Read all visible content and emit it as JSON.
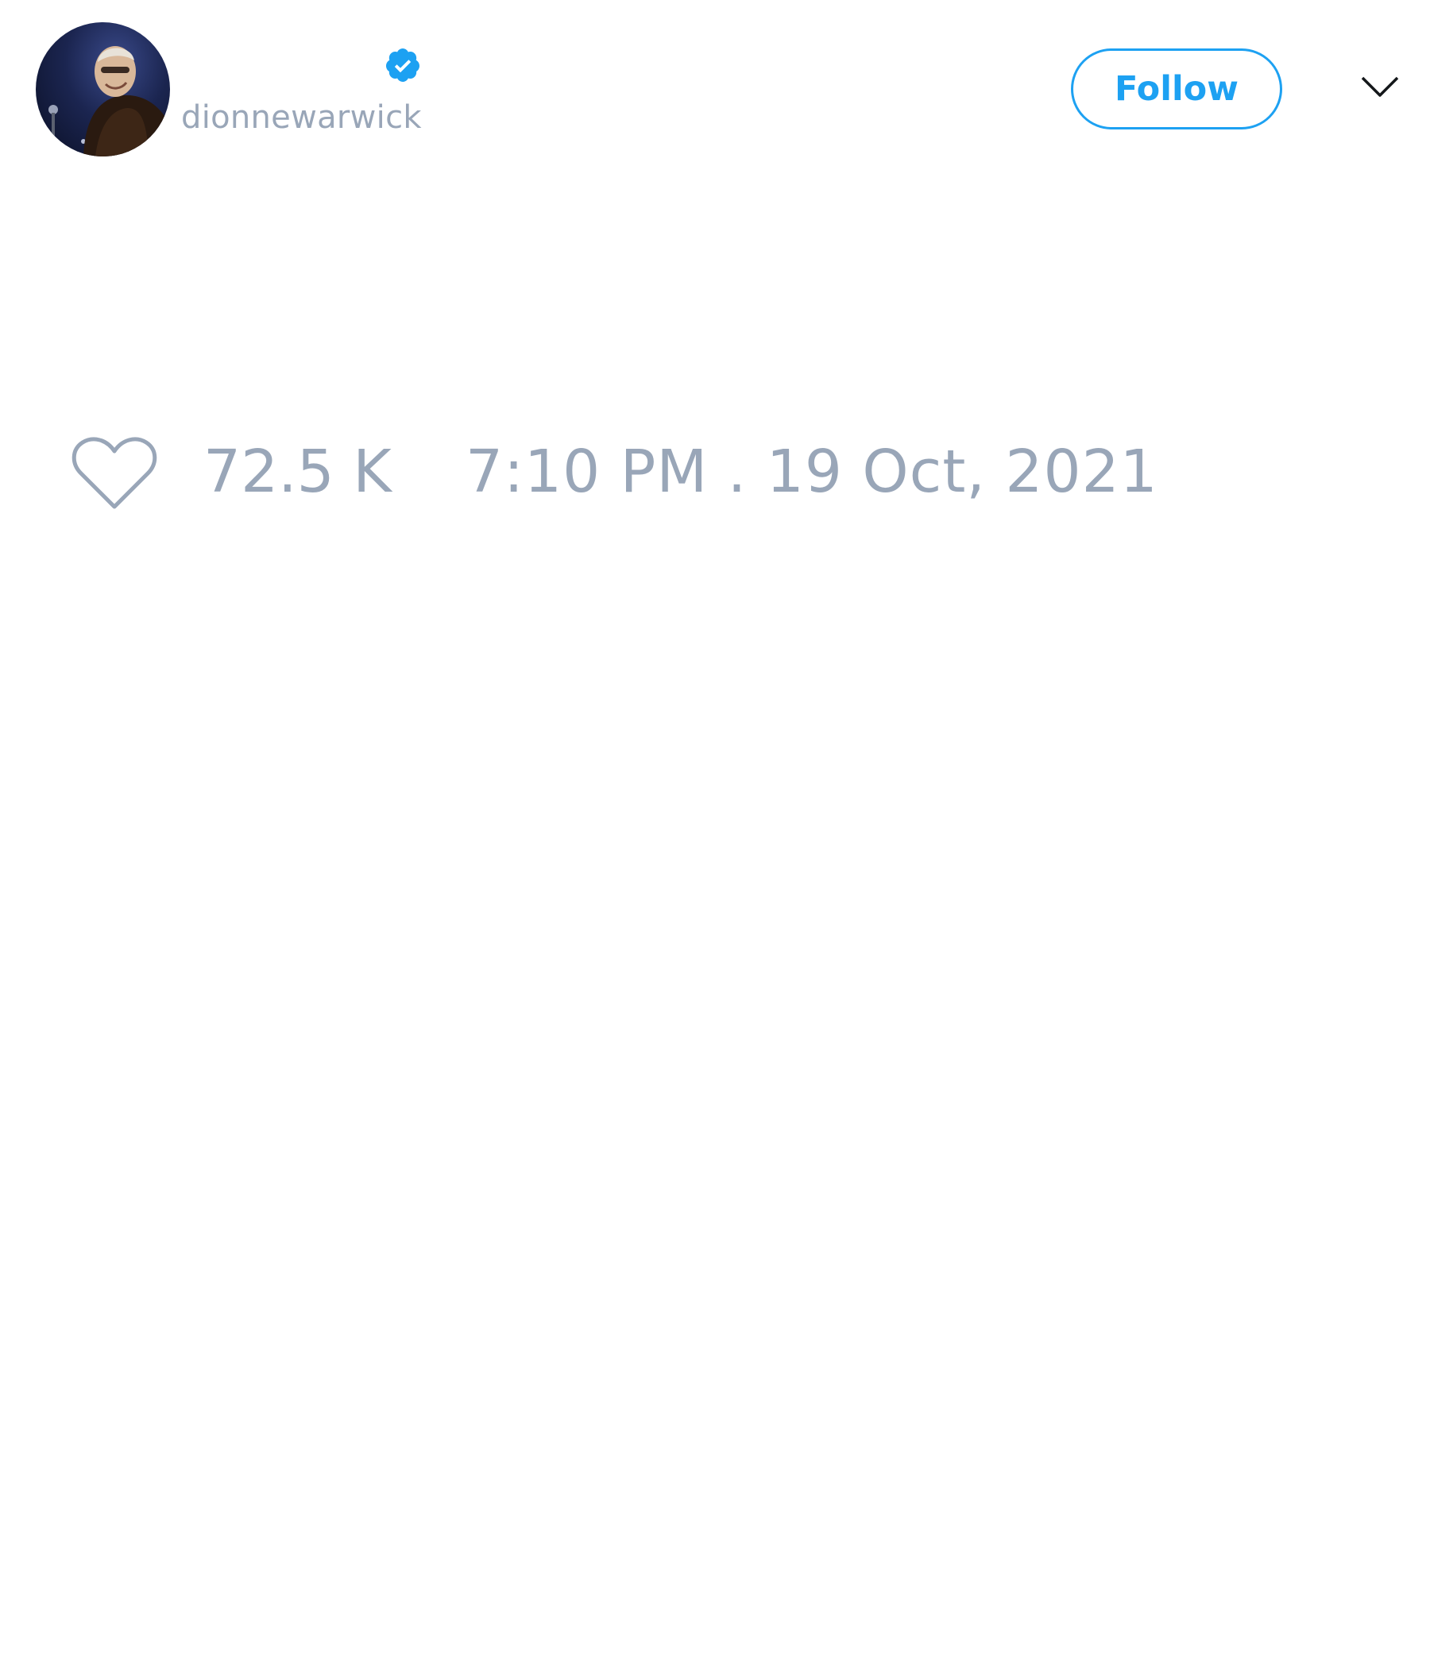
{
  "tweet": {
    "author": {
      "handle": "dionnewarwick",
      "verified": true,
      "avatar": "profile-photo-avatar"
    },
    "actions": {
      "follow_label": "Follow",
      "more_icon": "chevron-down-icon"
    },
    "stats": {
      "like_icon": "heart-outline-icon",
      "like_count": "72.5 K"
    },
    "timestamp": "7:10 PM . 19 Oct, 2021"
  },
  "colors": {
    "accent": "#1da1f2",
    "muted_text": "#99a6b8",
    "background": "#ffffff",
    "icon_dark": "#14171a"
  }
}
